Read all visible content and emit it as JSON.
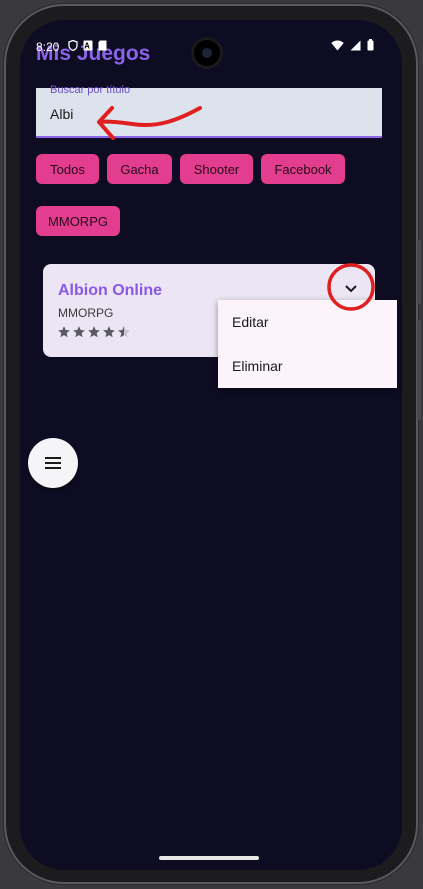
{
  "status_bar": {
    "time": "8:20",
    "left_icons": [
      "shield-icon",
      "a-icon",
      "sd-card-icon"
    ],
    "right_icons": [
      "wifi-icon",
      "signal-icon",
      "battery-icon"
    ]
  },
  "app": {
    "title": "Mis Juegos"
  },
  "search": {
    "label": "Buscar por título",
    "value": "Albi"
  },
  "filters": [
    {
      "label": "Todos"
    },
    {
      "label": "Gacha"
    },
    {
      "label": "Shooter"
    },
    {
      "label": "Facebook"
    },
    {
      "label": "MMORPG"
    }
  ],
  "game_card": {
    "title": "Albion Online",
    "genre": "MMORPG",
    "rating": 4.5,
    "rating_max": 5,
    "expand_icon": "chevron-down-icon"
  },
  "context_menu": {
    "items": [
      {
        "label": "Editar"
      },
      {
        "label": "Eliminar"
      }
    ]
  },
  "fab": {
    "icon": "menu-icon"
  },
  "colors": {
    "background": "#0e0c22",
    "accent_purple": "#8a63e8",
    "chip_pink": "#e23d8e",
    "card": "#ece6f4",
    "annotation_red": "#e02020"
  }
}
